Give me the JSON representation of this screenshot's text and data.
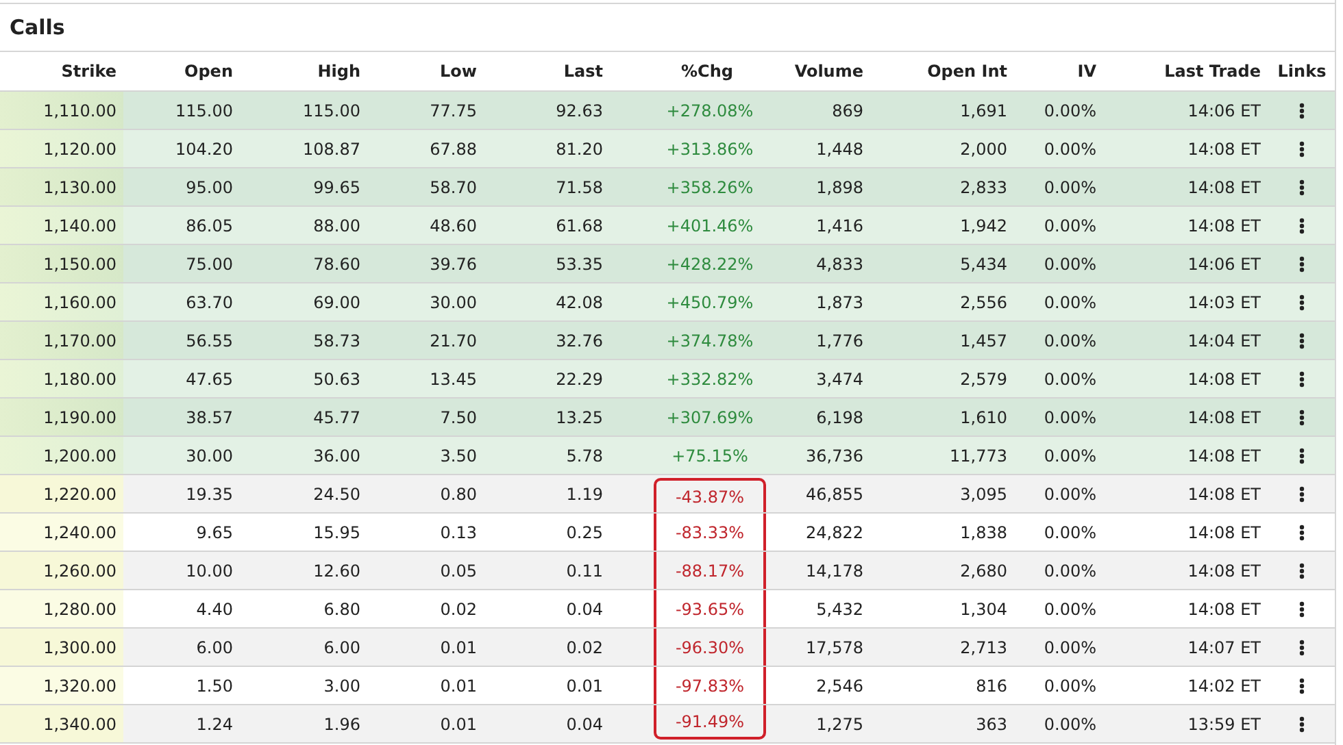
{
  "title": "Calls",
  "columns": [
    "Strike",
    "Open",
    "High",
    "Low",
    "Last",
    "%Chg",
    "Volume",
    "Open Int",
    "IV",
    "Last Trade",
    "Links"
  ],
  "rows": [
    {
      "strike": "1,110.00",
      "open": "115.00",
      "high": "115.00",
      "low": "77.75",
      "last": "92.63",
      "change": "+278.08%",
      "gain": true,
      "volume": "869",
      "open_int": "1,691",
      "iv": "0.00%",
      "last_trade": "14:06 ET",
      "in_the_money": true,
      "highlighted": false
    },
    {
      "strike": "1,120.00",
      "open": "104.20",
      "high": "108.87",
      "low": "67.88",
      "last": "81.20",
      "change": "+313.86%",
      "gain": true,
      "volume": "1,448",
      "open_int": "2,000",
      "iv": "0.00%",
      "last_trade": "14:08 ET",
      "in_the_money": true,
      "highlighted": false
    },
    {
      "strike": "1,130.00",
      "open": "95.00",
      "high": "99.65",
      "low": "58.70",
      "last": "71.58",
      "change": "+358.26%",
      "gain": true,
      "volume": "1,898",
      "open_int": "2,833",
      "iv": "0.00%",
      "last_trade": "14:08 ET",
      "in_the_money": true,
      "highlighted": false
    },
    {
      "strike": "1,140.00",
      "open": "86.05",
      "high": "88.00",
      "low": "48.60",
      "last": "61.68",
      "change": "+401.46%",
      "gain": true,
      "volume": "1,416",
      "open_int": "1,942",
      "iv": "0.00%",
      "last_trade": "14:08 ET",
      "in_the_money": true,
      "highlighted": false
    },
    {
      "strike": "1,150.00",
      "open": "75.00",
      "high": "78.60",
      "low": "39.76",
      "last": "53.35",
      "change": "+428.22%",
      "gain": true,
      "volume": "4,833",
      "open_int": "5,434",
      "iv": "0.00%",
      "last_trade": "14:06 ET",
      "in_the_money": true,
      "highlighted": false
    },
    {
      "strike": "1,160.00",
      "open": "63.70",
      "high": "69.00",
      "low": "30.00",
      "last": "42.08",
      "change": "+450.79%",
      "gain": true,
      "volume": "1,873",
      "open_int": "2,556",
      "iv": "0.00%",
      "last_trade": "14:03 ET",
      "in_the_money": true,
      "highlighted": false
    },
    {
      "strike": "1,170.00",
      "open": "56.55",
      "high": "58.73",
      "low": "21.70",
      "last": "32.76",
      "change": "+374.78%",
      "gain": true,
      "volume": "1,776",
      "open_int": "1,457",
      "iv": "0.00%",
      "last_trade": "14:04 ET",
      "in_the_money": true,
      "highlighted": false
    },
    {
      "strike": "1,180.00",
      "open": "47.65",
      "high": "50.63",
      "low": "13.45",
      "last": "22.29",
      "change": "+332.82%",
      "gain": true,
      "volume": "3,474",
      "open_int": "2,579",
      "iv": "0.00%",
      "last_trade": "14:08 ET",
      "in_the_money": true,
      "highlighted": false
    },
    {
      "strike": "1,190.00",
      "open": "38.57",
      "high": "45.77",
      "low": "7.50",
      "last": "13.25",
      "change": "+307.69%",
      "gain": true,
      "volume": "6,198",
      "open_int": "1,610",
      "iv": "0.00%",
      "last_trade": "14:08 ET",
      "in_the_money": true,
      "highlighted": false
    },
    {
      "strike": "1,200.00",
      "open": "30.00",
      "high": "36.00",
      "low": "3.50",
      "last": "5.78",
      "change": "+75.15%",
      "gain": true,
      "volume": "36,736",
      "open_int": "11,773",
      "iv": "0.00%",
      "last_trade": "14:08 ET",
      "in_the_money": true,
      "highlighted": false
    },
    {
      "strike": "1,220.00",
      "open": "19.35",
      "high": "24.50",
      "low": "0.80",
      "last": "1.19",
      "change": "-43.87%",
      "gain": false,
      "volume": "46,855",
      "open_int": "3,095",
      "iv": "0.00%",
      "last_trade": "14:08 ET",
      "in_the_money": false,
      "highlighted": true
    },
    {
      "strike": "1,240.00",
      "open": "9.65",
      "high": "15.95",
      "low": "0.13",
      "last": "0.25",
      "change": "-83.33%",
      "gain": false,
      "volume": "24,822",
      "open_int": "1,838",
      "iv": "0.00%",
      "last_trade": "14:08 ET",
      "in_the_money": false,
      "highlighted": true
    },
    {
      "strike": "1,260.00",
      "open": "10.00",
      "high": "12.60",
      "low": "0.05",
      "last": "0.11",
      "change": "-88.17%",
      "gain": false,
      "volume": "14,178",
      "open_int": "2,680",
      "iv": "0.00%",
      "last_trade": "14:08 ET",
      "in_the_money": false,
      "highlighted": true
    },
    {
      "strike": "1,280.00",
      "open": "4.40",
      "high": "6.80",
      "low": "0.02",
      "last": "0.04",
      "change": "-93.65%",
      "gain": false,
      "volume": "5,432",
      "open_int": "1,304",
      "iv": "0.00%",
      "last_trade": "14:08 ET",
      "in_the_money": false,
      "highlighted": true
    },
    {
      "strike": "1,300.00",
      "open": "6.00",
      "high": "6.00",
      "low": "0.01",
      "last": "0.02",
      "change": "-96.30%",
      "gain": false,
      "volume": "17,578",
      "open_int": "2,713",
      "iv": "0.00%",
      "last_trade": "14:07 ET",
      "in_the_money": false,
      "highlighted": true
    },
    {
      "strike": "1,320.00",
      "open": "1.50",
      "high": "3.00",
      "low": "0.01",
      "last": "0.01",
      "change": "-97.83%",
      "gain": false,
      "volume": "2,546",
      "open_int": "816",
      "iv": "0.00%",
      "last_trade": "14:02 ET",
      "in_the_money": false,
      "highlighted": true
    },
    {
      "strike": "1,340.00",
      "open": "1.24",
      "high": "1.96",
      "low": "0.01",
      "last": "0.04",
      "change": "-91.49%",
      "gain": false,
      "volume": "1,275",
      "open_int": "363",
      "iv": "0.00%",
      "last_trade": "13:59 ET",
      "in_the_money": false,
      "highlighted": true
    }
  ]
}
